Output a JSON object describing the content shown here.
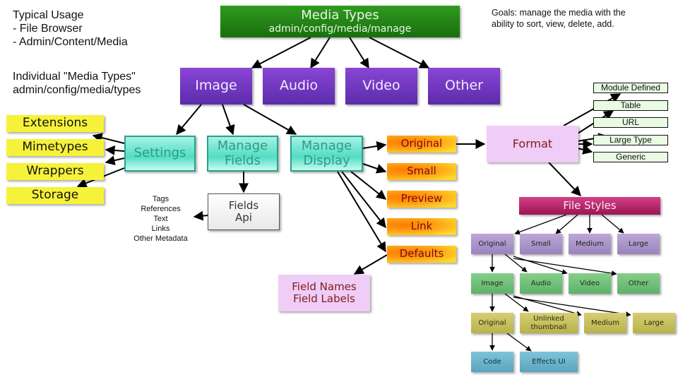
{
  "notes": {
    "typical_usage": [
      "Typical Usage",
      "- File Browser",
      "- Admin/Content/Media"
    ],
    "individual_types": [
      "Individual \"Media Types\"",
      "admin/config/media/types"
    ],
    "goals": [
      "Goals: manage the media with the",
      "ability to sort, view, delete, add."
    ]
  },
  "root": {
    "title": "Media Types",
    "path": "admin/config/media/manage"
  },
  "media_types": [
    "Image",
    "Audio",
    "Video",
    "Other"
  ],
  "image_children": {
    "settings": "Settings",
    "manage_fields": [
      "Manage",
      "Fields"
    ],
    "manage_display": [
      "Manage",
      "Display"
    ]
  },
  "settings_items": [
    "Extensions",
    "Mimetypes",
    "Wrappers",
    "Storage"
  ],
  "fields_api": [
    "Fields",
    "Api"
  ],
  "field_types": [
    "Tags",
    "References",
    "Text",
    "Links",
    "Other Metadata"
  ],
  "display_modes": [
    "Original",
    "Small",
    "Preview",
    "Link",
    "Defaults"
  ],
  "field_names": [
    "Field Names",
    "Field Labels"
  ],
  "format": "Format",
  "format_types": [
    "Module Defined",
    "Table",
    "URL",
    "Large Type",
    "Generic"
  ],
  "file_styles": {
    "title": "File Styles",
    "sizes": [
      "Original",
      "Small",
      "Medium",
      "Large"
    ],
    "media": [
      "Image",
      "Audio",
      "Video",
      "Other"
    ],
    "image_styles": [
      "Original",
      [
        "Unlinked",
        "thumbnail"
      ],
      "Medium",
      "Large"
    ],
    "original_children": [
      "Code",
      "Effects UI"
    ]
  },
  "colors": {
    "root_green": "#1f7f12",
    "media_purple": "#6e35c2",
    "teal_border": "#2aa08a",
    "yellow": "#f6f23a",
    "orange": "#ffa216",
    "pink": "#efcdf7",
    "magenta": "#b82a6e",
    "lavender": "#ac95cb",
    "mint": "#72c17a",
    "olive": "#c7c15f",
    "cyan": "#6cb4ca"
  }
}
